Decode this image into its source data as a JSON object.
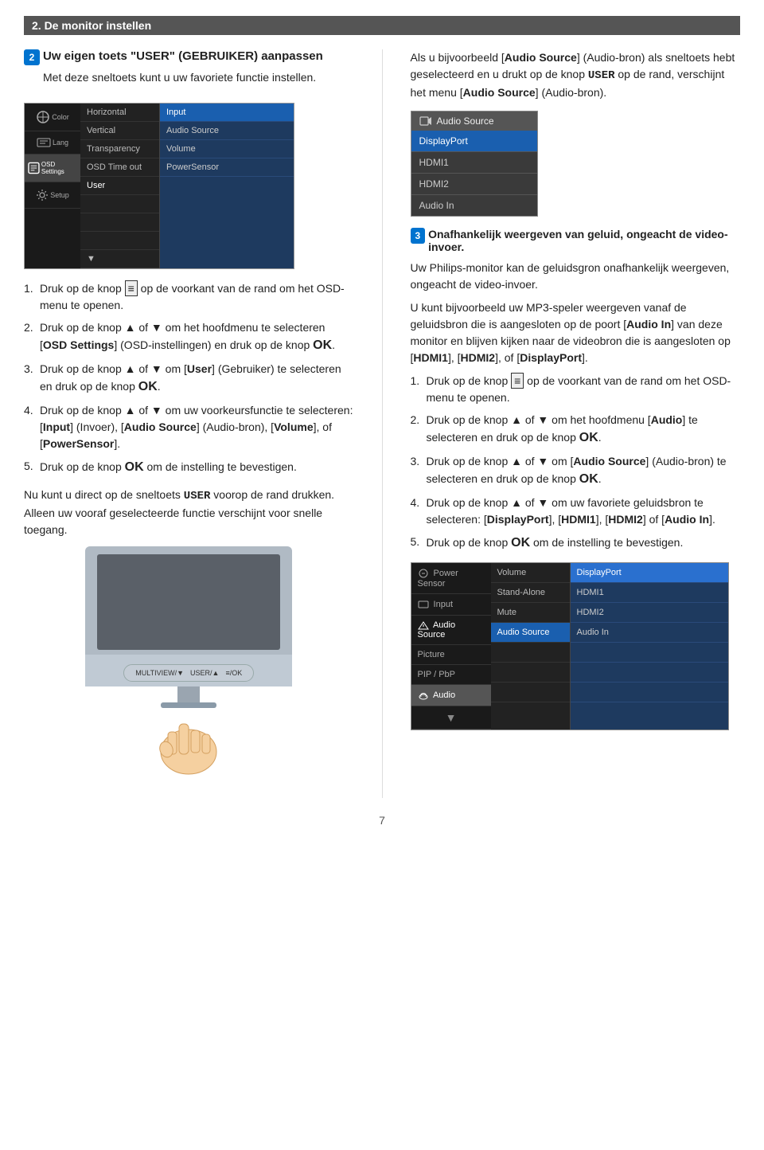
{
  "page": {
    "title": "2. De monitor instellen",
    "page_number": "7"
  },
  "left_col": {
    "heading": "Uw eigen toets \"USER\" (GEBRUIKER) aanpassen",
    "subheading": "Met deze sneltoets kunt u uw favoriete functie instellen.",
    "steps": [
      {
        "num": "1.",
        "text": "Druk op de knop",
        "icon": "menu-icon",
        "rest": "op de voorkant van de rand om het OSD-menu te openen."
      },
      {
        "num": "2.",
        "text": "Druk op de knop ▲ of ▼ om het hoofdmenu te selecteren [OSD Settings] (OSD-instellingen) en druk op de knop OK."
      },
      {
        "num": "3.",
        "text": "Druk op de knop ▲ of ▼ om [User] (Gebruiker) te selecteren en druk op de knop OK."
      },
      {
        "num": "4.",
        "text": "Druk op de knop ▲ of ▼ om uw voorkeursfunctie te selecteren: [Input] (Invoer), [Audio Source] (Audio-bron), [Volume], of [PowerSensor]."
      },
      {
        "num": "5.",
        "text": "Druk op de knop OK om de instelling te bevestigen."
      }
    ],
    "note_line1": "Nu kunt u direct op de sneltoets USER voorop de rand drukken. Alleen uw vooraf geselecteerde functie verschijnt voor snelle toegang.",
    "osd_menu": {
      "icons": [
        "Color",
        "Language",
        "OSD Settings",
        "Setup"
      ],
      "middle_items": [
        "Horizontal",
        "Vertical",
        "Transparency",
        "OSD Time out",
        "User"
      ],
      "right_items": [
        "Input",
        "Audio Source",
        "Volume",
        "PowerSensor"
      ],
      "highlighted_left": "OSD Settings",
      "highlighted_right": "Input"
    },
    "monitor_buttons": {
      "multiview": "MULTIVIEW/▼",
      "user": "USER/▲",
      "ok": "≡/OK"
    }
  },
  "right_col": {
    "intro": "Als u bijvoorbeeld [Audio Source] (Audio-bron) als sneltoets hebt geselecteerd en u drukt op de knop USER op de rand, verschijnt het menu [Audio Source] (Audio-bron).",
    "audio_source_menu": {
      "header": "Audio Source",
      "items": [
        "DisplayPort",
        "HDMI1",
        "HDMI2",
        "Audio In"
      ],
      "active": "DisplayPort"
    },
    "step3_heading": "Onafhankelijk weergeven van geluid, ongeacht de video-invoer.",
    "step3_body1": "Uw Philips-monitor kan de geluidsgron onafhankelijk weergeven, ongeacht de video-invoer.",
    "step3_body2": "U kunt bijvoorbeeld uw MP3-speler weergeven vanaf de geluidsbron die is aangesloten op de poort [Audio In] van deze monitor en blijven kijken naar de videobron die is aangesloten op [HDMI1], [HDMI2], of [DisplayPort].",
    "sub_steps": [
      {
        "num": "1.",
        "text": "Druk op de knop",
        "icon": "menu-icon",
        "rest": "op de voorkant van de rand om het OSD-menu te openen."
      },
      {
        "num": "2.",
        "text": "Druk op de knop ▲ of ▼ om het hoofdmenu [Audio] te selecteren en druk op de knop OK."
      },
      {
        "num": "3.",
        "text": "Druk op de knop ▲ of ▼ om [Audio Source] (Audio-bron) te selecteren en druk op de knop OK."
      },
      {
        "num": "4.",
        "text": "Druk op de knop ▲ of ▼ om uw favoriete geluidsbron te selecteren: [DisplayPort], [HDMI1], [HDMI2] of [Audio In]."
      },
      {
        "num": "5.",
        "text": "Druk op de knop OK om de instelling te bevestigen."
      }
    ],
    "osd_menu2": {
      "left_items": [
        "Power Sensor",
        "Input",
        "Audio Source",
        "Picture",
        "PIP/PbP",
        "Audio"
      ],
      "middle_items": [
        "Volume",
        "Stand-Alone",
        "Mute",
        "Audio Source"
      ],
      "right_items": [
        "DisplayPort",
        "HDMI1",
        "HDMI2",
        "Audio In"
      ],
      "highlighted_left": "Audio",
      "highlighted_middle": "Audio Source",
      "highlighted_right": "DisplayPort"
    }
  }
}
